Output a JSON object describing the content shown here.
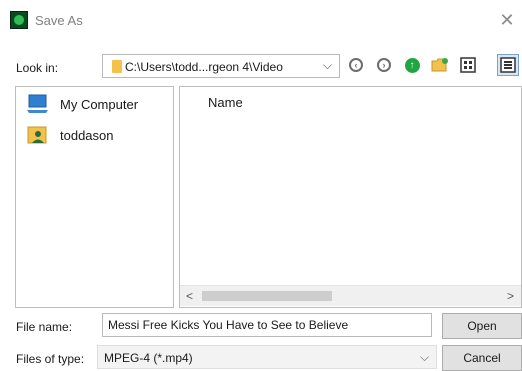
{
  "window": {
    "title": "Save As",
    "close_glyph": "✕",
    "app_icon": "app-icon"
  },
  "lookin": {
    "label": "Look in:",
    "path": "C:\\Users\\todd...rgeon 4\\Video",
    "arrow": "⌵"
  },
  "toolbar": {
    "back_icon": "back-icon",
    "forward_icon": "forward-icon",
    "up_icon": "up-folder-icon",
    "new_folder_icon": "new-folder-icon",
    "list_view_icon": "list-view-icon",
    "details_view_icon": "details-view-icon"
  },
  "places": [
    {
      "label": "My Computer",
      "icon": "computer-icon"
    },
    {
      "label": "toddason",
      "icon": "user-folder-icon"
    }
  ],
  "filelist": {
    "column_name": "Name",
    "scroll_left": "<",
    "scroll_right": ">"
  },
  "filename": {
    "label": "File name:",
    "value": "Messi Free Kicks You Have to See to Believe"
  },
  "filetype": {
    "label": "Files of type:",
    "value": "MPEG-4 (*.mp4)",
    "arrow": "⌵"
  },
  "buttons": {
    "open": "Open",
    "cancel": "Cancel"
  },
  "colors": {
    "accent_green": "#20a640",
    "folder_yellow": "#f2c24d",
    "button_gray": "#e1e1e1"
  }
}
